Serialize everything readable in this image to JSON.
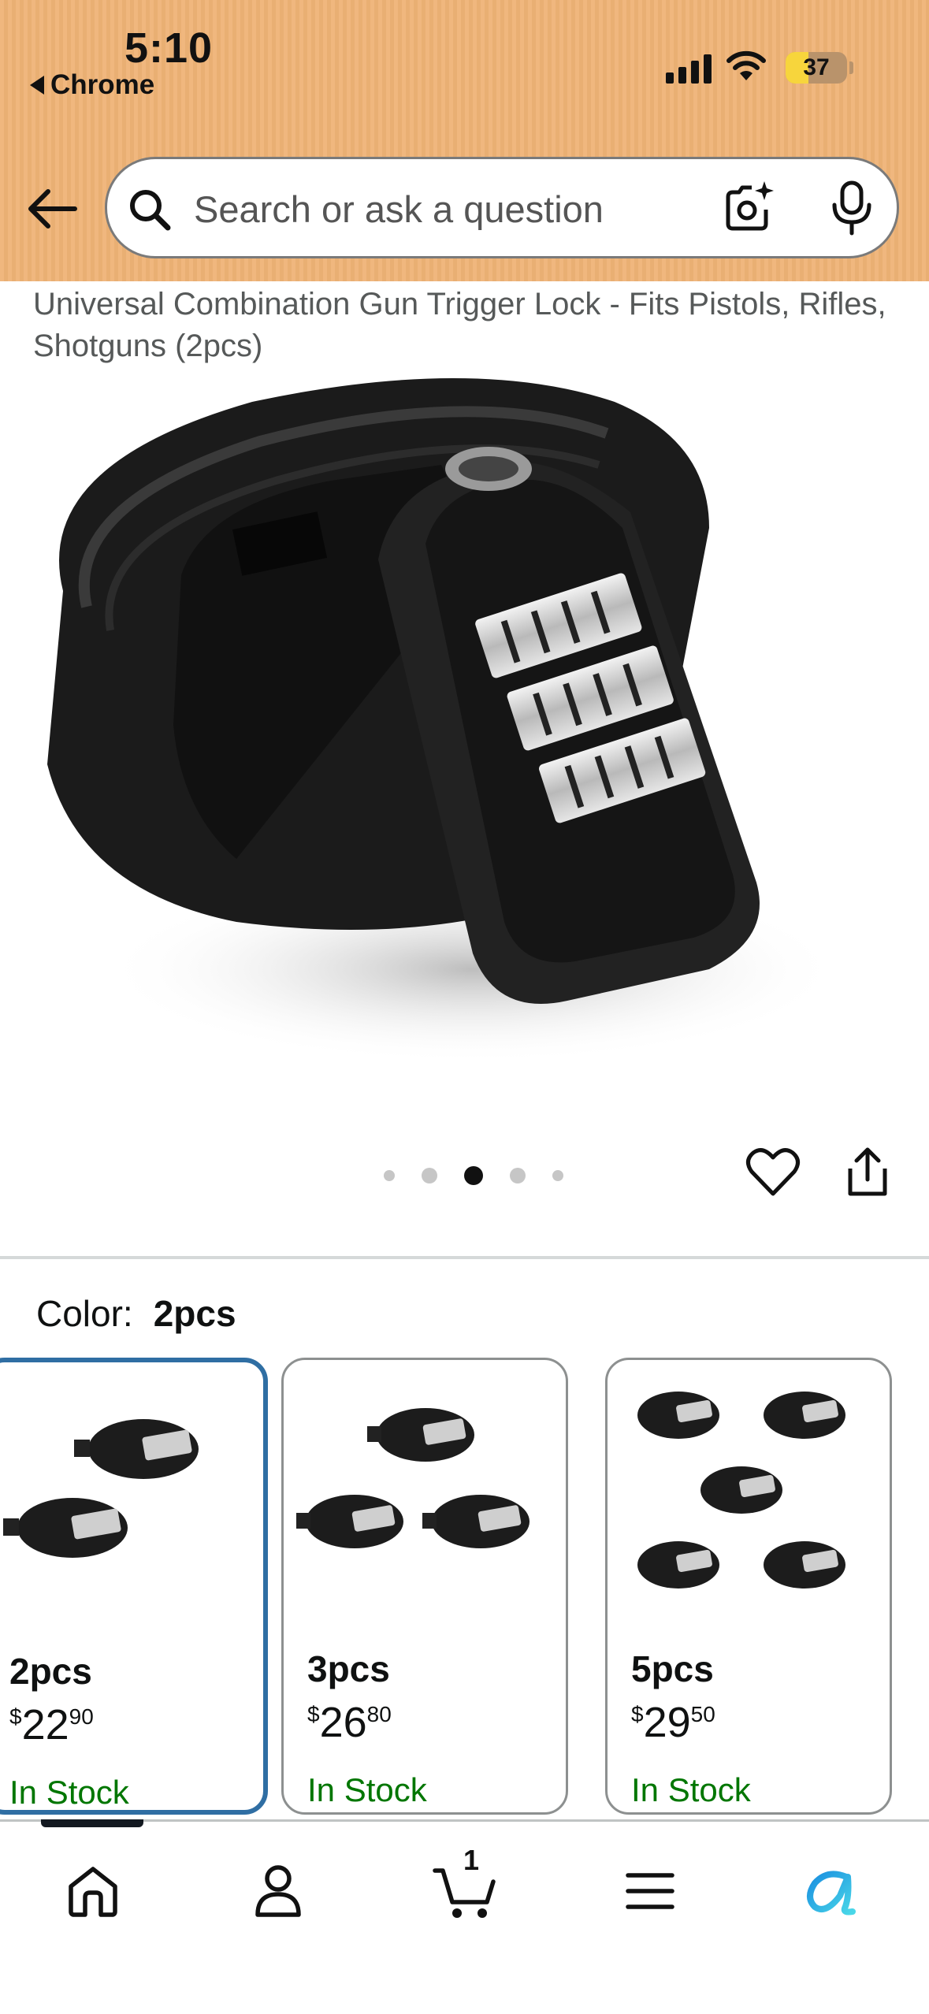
{
  "status_bar": {
    "time": "5:10",
    "back_app": "Chrome",
    "battery": "37",
    "battery_level": 0.37
  },
  "search": {
    "placeholder": "Search or ask a question"
  },
  "product": {
    "title": "Universal Combination Gun Trigger Lock - Fits Pistols, Rifles, Shotguns (2pcs)",
    "image_count": 5,
    "active_image": 3
  },
  "color": {
    "label": "Color:",
    "value": "2pcs"
  },
  "variants": [
    {
      "name": "2pcs",
      "currency": "$",
      "whole": "22",
      "fraction": "90",
      "stock": "In Stock",
      "selected": true
    },
    {
      "name": "3pcs",
      "currency": "$",
      "whole": "26",
      "fraction": "80",
      "stock": "In Stock",
      "selected": false
    },
    {
      "name": "5pcs",
      "currency": "$",
      "whole": "29",
      "fraction": "50",
      "stock": "In Stock",
      "selected": false
    }
  ],
  "nav": {
    "cart_count": "1",
    "items": [
      "home-icon",
      "account-icon",
      "cart-icon",
      "menu-icon",
      "rufus-icon"
    ]
  },
  "colors": {
    "header": "#f0b77e",
    "selected_border": "#2f6ea3",
    "in_stock": "#007600"
  }
}
